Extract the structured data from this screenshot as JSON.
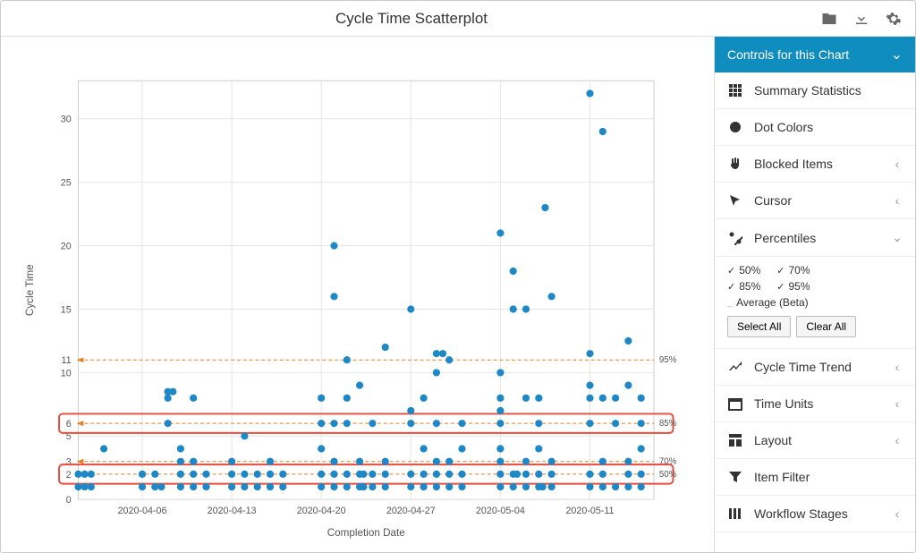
{
  "title": "Cycle Time Scatterplot",
  "sidebar": {
    "header": "Controls for this Chart",
    "items": {
      "summary": "Summary Statistics",
      "dotcolors": "Dot Colors",
      "blocked": "Blocked Items",
      "cursor": "Cursor",
      "percentiles": "Percentiles",
      "trend": "Cycle Time Trend",
      "timeunits": "Time Units",
      "layout": "Layout",
      "itemfilter": "Item Filter",
      "workflow": "Workflow Stages"
    },
    "percentiles_panel": {
      "p50": "50%",
      "p70": "70%",
      "p85": "85%",
      "p95": "95%",
      "avg": "Average (Beta)",
      "select_all": "Select All",
      "clear_all": "Clear All"
    }
  },
  "chart_data": {
    "type": "scatter",
    "title": "Cycle Time Scatterplot",
    "xlabel": "Completion Date",
    "ylabel": "Cycle Time",
    "ylim": [
      0,
      33
    ],
    "y_ticks_major": [
      0,
      5,
      10,
      15,
      20,
      25,
      30
    ],
    "y_ticks_extra": [
      2,
      3,
      6,
      11
    ],
    "x_ticks": [
      "2020-04-06",
      "2020-04-13",
      "2020-04-20",
      "2020-04-27",
      "2020-05-04",
      "2020-05-11"
    ],
    "x_range_days": [
      0,
      45
    ],
    "percentile_lines": [
      {
        "label": "95%",
        "y": 11
      },
      {
        "label": "85%",
        "y": 6
      },
      {
        "label": "70%",
        "y": 3
      },
      {
        "label": "50%",
        "y": 2
      }
    ],
    "highlight_bands": [
      {
        "y_center": 6
      },
      {
        "y_center": 2
      }
    ],
    "points": [
      {
        "x": 0,
        "y": 1
      },
      {
        "x": 0,
        "y": 2
      },
      {
        "x": 0.5,
        "y": 1
      },
      {
        "x": 0.5,
        "y": 2
      },
      {
        "x": 1,
        "y": 1
      },
      {
        "x": 1,
        "y": 2
      },
      {
        "x": 2,
        "y": 4
      },
      {
        "x": 5,
        "y": 1
      },
      {
        "x": 5,
        "y": 2
      },
      {
        "x": 6,
        "y": 1
      },
      {
        "x": 6,
        "y": 2
      },
      {
        "x": 6.5,
        "y": 1
      },
      {
        "x": 7,
        "y": 6
      },
      {
        "x": 7,
        "y": 8
      },
      {
        "x": 7,
        "y": 8.5
      },
      {
        "x": 7.4,
        "y": 8.5
      },
      {
        "x": 8,
        "y": 1
      },
      {
        "x": 8,
        "y": 2
      },
      {
        "x": 8,
        "y": 3
      },
      {
        "x": 8,
        "y": 4
      },
      {
        "x": 9,
        "y": 1
      },
      {
        "x": 9,
        "y": 2
      },
      {
        "x": 9,
        "y": 3
      },
      {
        "x": 9,
        "y": 8
      },
      {
        "x": 10,
        "y": 1
      },
      {
        "x": 10,
        "y": 2
      },
      {
        "x": 12,
        "y": 1
      },
      {
        "x": 12,
        "y": 2
      },
      {
        "x": 12,
        "y": 3
      },
      {
        "x": 13,
        "y": 1
      },
      {
        "x": 13,
        "y": 2
      },
      {
        "x": 13,
        "y": 5
      },
      {
        "x": 14,
        "y": 1
      },
      {
        "x": 14,
        "y": 2
      },
      {
        "x": 15,
        "y": 1
      },
      {
        "x": 15,
        "y": 2
      },
      {
        "x": 15,
        "y": 3
      },
      {
        "x": 16,
        "y": 1
      },
      {
        "x": 16,
        "y": 2
      },
      {
        "x": 19,
        "y": 1
      },
      {
        "x": 19,
        "y": 2
      },
      {
        "x": 19,
        "y": 4
      },
      {
        "x": 19,
        "y": 6
      },
      {
        "x": 19,
        "y": 8
      },
      {
        "x": 20,
        "y": 1
      },
      {
        "x": 20,
        "y": 2
      },
      {
        "x": 20,
        "y": 3
      },
      {
        "x": 20,
        "y": 6
      },
      {
        "x": 20,
        "y": 16
      },
      {
        "x": 20,
        "y": 20
      },
      {
        "x": 21,
        "y": 1
      },
      {
        "x": 21,
        "y": 2
      },
      {
        "x": 21,
        "y": 6
      },
      {
        "x": 21,
        "y": 8
      },
      {
        "x": 21,
        "y": 11
      },
      {
        "x": 22,
        "y": 1
      },
      {
        "x": 22,
        "y": 2
      },
      {
        "x": 22,
        "y": 3
      },
      {
        "x": 22.3,
        "y": 1
      },
      {
        "x": 22.3,
        "y": 2
      },
      {
        "x": 22,
        "y": 9
      },
      {
        "x": 23,
        "y": 1
      },
      {
        "x": 23,
        "y": 2
      },
      {
        "x": 23,
        "y": 6
      },
      {
        "x": 24,
        "y": 1
      },
      {
        "x": 24,
        "y": 2
      },
      {
        "x": 24,
        "y": 3
      },
      {
        "x": 24,
        "y": 12
      },
      {
        "x": 26,
        "y": 1
      },
      {
        "x": 26,
        "y": 2
      },
      {
        "x": 26,
        "y": 6
      },
      {
        "x": 26,
        "y": 7
      },
      {
        "x": 26,
        "y": 15
      },
      {
        "x": 27,
        "y": 1
      },
      {
        "x": 27,
        "y": 2
      },
      {
        "x": 27,
        "y": 4
      },
      {
        "x": 27,
        "y": 8
      },
      {
        "x": 28,
        "y": 1
      },
      {
        "x": 28,
        "y": 2
      },
      {
        "x": 28,
        "y": 3
      },
      {
        "x": 28,
        "y": 6
      },
      {
        "x": 28,
        "y": 10
      },
      {
        "x": 28,
        "y": 11.5
      },
      {
        "x": 28.5,
        "y": 11.5
      },
      {
        "x": 29,
        "y": 1
      },
      {
        "x": 29,
        "y": 2
      },
      {
        "x": 29,
        "y": 3
      },
      {
        "x": 29,
        "y": 11
      },
      {
        "x": 30,
        "y": 1
      },
      {
        "x": 30,
        "y": 2
      },
      {
        "x": 30,
        "y": 4
      },
      {
        "x": 30,
        "y": 6
      },
      {
        "x": 33,
        "y": 1
      },
      {
        "x": 33,
        "y": 2
      },
      {
        "x": 33,
        "y": 3
      },
      {
        "x": 33,
        "y": 4
      },
      {
        "x": 33,
        "y": 6
      },
      {
        "x": 33,
        "y": 7
      },
      {
        "x": 33,
        "y": 8
      },
      {
        "x": 33,
        "y": 10
      },
      {
        "x": 33,
        "y": 21
      },
      {
        "x": 34,
        "y": 1
      },
      {
        "x": 34,
        "y": 2
      },
      {
        "x": 34.3,
        "y": 2
      },
      {
        "x": 34,
        "y": 15
      },
      {
        "x": 34,
        "y": 18
      },
      {
        "x": 35,
        "y": 1
      },
      {
        "x": 35,
        "y": 2
      },
      {
        "x": 35,
        "y": 3
      },
      {
        "x": 35,
        "y": 8
      },
      {
        "x": 35,
        "y": 15
      },
      {
        "x": 36,
        "y": 1
      },
      {
        "x": 36,
        "y": 2
      },
      {
        "x": 36.3,
        "y": 1
      },
      {
        "x": 36,
        "y": 4
      },
      {
        "x": 36,
        "y": 6
      },
      {
        "x": 36,
        "y": 8
      },
      {
        "x": 36.5,
        "y": 23
      },
      {
        "x": 37,
        "y": 1
      },
      {
        "x": 37,
        "y": 2
      },
      {
        "x": 37,
        "y": 3
      },
      {
        "x": 37,
        "y": 16
      },
      {
        "x": 40,
        "y": 1
      },
      {
        "x": 40,
        "y": 2
      },
      {
        "x": 40,
        "y": 6
      },
      {
        "x": 40,
        "y": 8
      },
      {
        "x": 40,
        "y": 9
      },
      {
        "x": 40,
        "y": 11.5
      },
      {
        "x": 40,
        "y": 32
      },
      {
        "x": 41,
        "y": 1
      },
      {
        "x": 41,
        "y": 2
      },
      {
        "x": 41,
        "y": 3
      },
      {
        "x": 41,
        "y": 8
      },
      {
        "x": 41,
        "y": 29
      },
      {
        "x": 42,
        "y": 1
      },
      {
        "x": 42,
        "y": 6
      },
      {
        "x": 42,
        "y": 8
      },
      {
        "x": 43,
        "y": 1
      },
      {
        "x": 43,
        "y": 2
      },
      {
        "x": 43,
        "y": 3
      },
      {
        "x": 43,
        "y": 9
      },
      {
        "x": 43,
        "y": 12.5
      },
      {
        "x": 44,
        "y": 1
      },
      {
        "x": 44,
        "y": 2
      },
      {
        "x": 44,
        "y": 4
      },
      {
        "x": 44,
        "y": 6
      },
      {
        "x": 44,
        "y": 8
      }
    ]
  }
}
